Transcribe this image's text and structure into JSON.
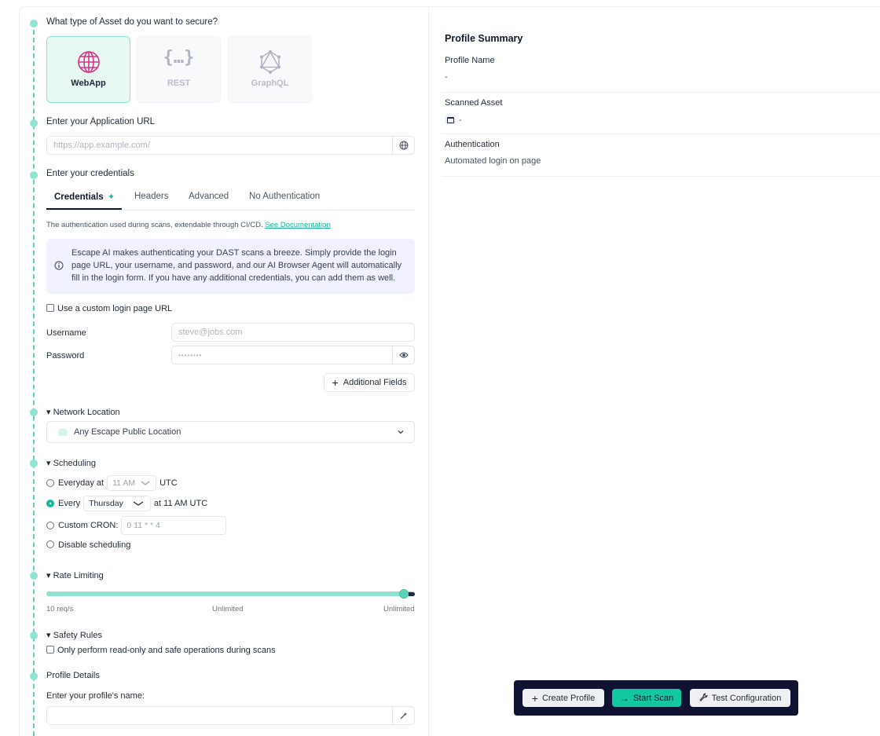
{
  "asset": {
    "question": "What type of Asset do you want to secure?",
    "types": [
      {
        "label": "WebApp",
        "icon": "globe-icon",
        "selected": true
      },
      {
        "label": "REST",
        "icon": "braces-icon",
        "selected": false
      },
      {
        "label": "GraphQL",
        "icon": "graphql-icon",
        "selected": false
      }
    ]
  },
  "url": {
    "label": "Enter your Application URL",
    "placeholder": "https://app.example.com/"
  },
  "credentials": {
    "label": "Enter your credentials",
    "tabs": [
      "Credentials",
      "Headers",
      "Advanced",
      "No Authentication"
    ],
    "active_tab": "Credentials",
    "hint": "The authentication used during scans, extendable through CI/CD.",
    "hint_link": "See Documentation",
    "info": "Escape AI makes authenticating your DAST scans a breeze. Simply provide the login page URL, your username, and password, and our AI Browser Agent will automatically fill in the login form. If you have any additional credentials, you can add them as well.",
    "custom_login_label": "Use a custom login page URL",
    "username_label": "Username",
    "username_placeholder": "steve@jobs.com",
    "password_label": "Password",
    "password_placeholder": "••••••••",
    "additional_fields": "Additional Fields"
  },
  "network": {
    "title": "▾ Network Location",
    "selected": "Any Escape Public Location"
  },
  "scheduling": {
    "title": "▾ Scheduling",
    "everyday_label": "Everyday at",
    "everyday_time": "11 AM",
    "utc": "UTC",
    "every_label": "Every",
    "every_day": "Thursday",
    "every_suffix": "at 11 AM UTC",
    "custom_label": "Custom CRON:",
    "custom_placeholder": "0 11 * * 4",
    "disable_label": "Disable scheduling",
    "selected": "every"
  },
  "rate": {
    "title": "▾ Rate Limiting",
    "min_label": "10 req/s",
    "mid_label": "Unlimited",
    "max_label": "Unlimited",
    "value_fraction": 0.97
  },
  "safety": {
    "title": "▾ Safety Rules",
    "checkbox_label": "Only perform read-only and safe operations during scans"
  },
  "profile": {
    "title": "Profile Details",
    "name_label": "Enter your profile's name:",
    "name_value": ""
  },
  "summary": {
    "title": "Profile Summary",
    "profile_name_key": "Profile Name",
    "profile_name_val": "-",
    "scanned_asset_key": "Scanned Asset",
    "scanned_asset_val": "-",
    "auth_key": "Authentication",
    "auth_val": "Automated login on page"
  },
  "actions": {
    "create": "Create Profile",
    "start": "Start Scan",
    "test": "Test Configuration"
  },
  "colors": {
    "accent": "#13c7a2",
    "timeline": "#5fd3b9",
    "action_bar": "#0f1230"
  }
}
